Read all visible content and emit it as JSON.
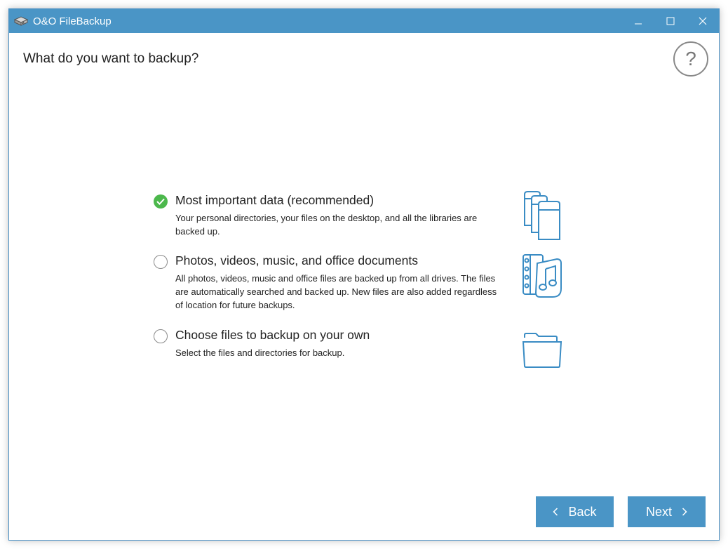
{
  "window": {
    "title": "O&O FileBackup",
    "controls": {
      "minimize_icon": "minimize-icon",
      "maximize_icon": "maximize-icon",
      "close_icon": "close-icon"
    }
  },
  "page": {
    "title": "What do you want to backup?",
    "help_label": "?"
  },
  "options": [
    {
      "title": "Most important data (recommended)",
      "description": "Your personal directories, your files on the desktop, and all the libraries are backed up.",
      "selected": true,
      "icon": "library-books-icon"
    },
    {
      "title": "Photos, videos, music, and office documents",
      "description": "All photos, videos, music and office files are backed up from all drives. The files are automatically searched and backed up. New files are also added regardless of location for future backups.",
      "selected": false,
      "icon": "media-files-icon"
    },
    {
      "title": "Choose files to backup on your own",
      "description": "Select the files and directories for backup.",
      "selected": false,
      "icon": "folder-icon"
    }
  ],
  "footer": {
    "back_label": "Back",
    "next_label": "Next"
  },
  "colors": {
    "accent": "#4a95c6",
    "check": "#4cb84c",
    "icon_stroke": "#3a8cc4"
  }
}
